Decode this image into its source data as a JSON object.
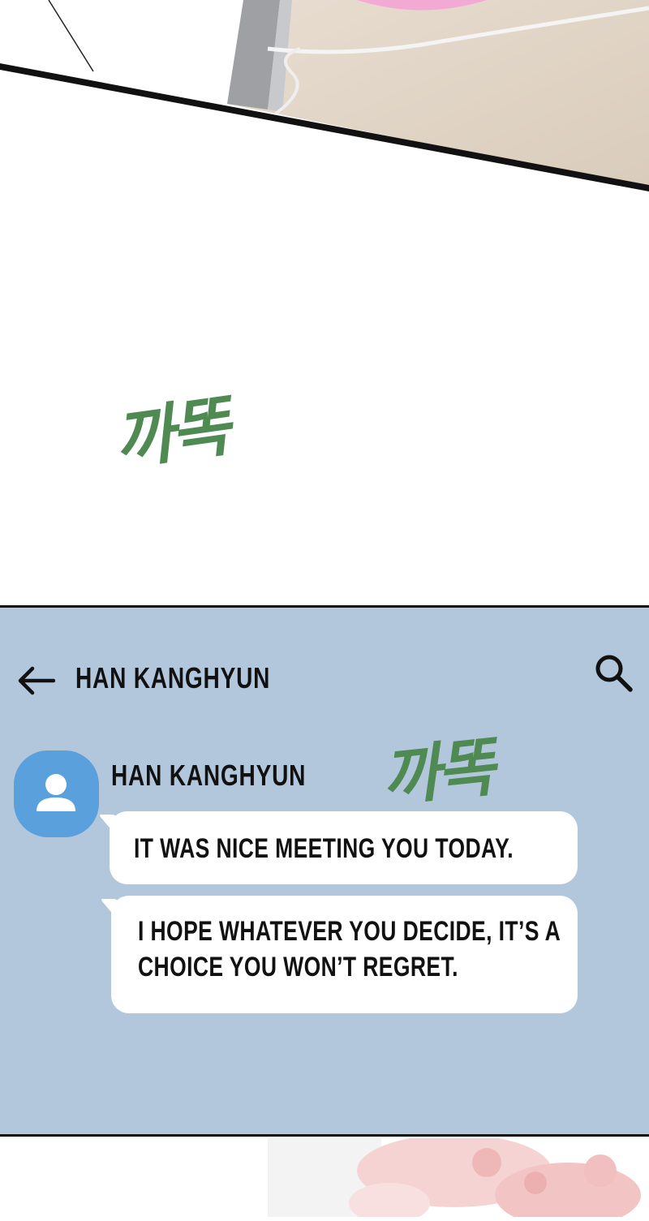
{
  "sfx": {
    "tap_1": "까똑",
    "tap_2": "까똑"
  },
  "chat": {
    "header_title": "HAN KANGHYUN",
    "sender_name": "HAN KANGHYUN",
    "messages": [
      {
        "text": "IT WAS NICE MEETING YOU TODAY."
      },
      {
        "line1": "I HOPE WHATEVER YOU DECIDE, IT’S A",
        "line2": "CHOICE YOU WON’T REGRET."
      }
    ],
    "icons": {
      "back": "back-arrow-icon",
      "search": "search-icon",
      "avatar": "person-avatar-icon"
    },
    "colors": {
      "background": "#b3c7dc",
      "bubble": "#ffffff",
      "avatar": "#5aa0dc",
      "sfx": "#4f8a52"
    }
  }
}
